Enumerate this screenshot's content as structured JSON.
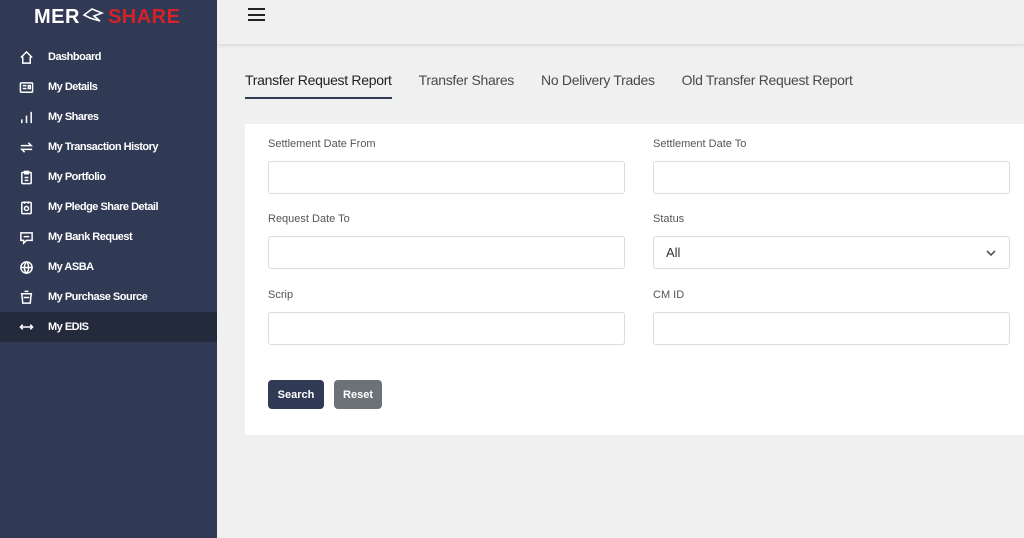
{
  "brand": {
    "part1": "MER",
    "part2": "SHARE"
  },
  "sidebar": {
    "items": [
      {
        "label": "Dashboard",
        "icon": "home-icon"
      },
      {
        "label": "My Details",
        "icon": "id-card-icon"
      },
      {
        "label": "My Shares",
        "icon": "bar-chart-icon"
      },
      {
        "label": "My Transaction History",
        "icon": "transfer-arrows-icon"
      },
      {
        "label": "My Portfolio",
        "icon": "clipboard-icon"
      },
      {
        "label": "My Pledge Share Detail",
        "icon": "pledge-clipboard-icon"
      },
      {
        "label": "My Bank Request",
        "icon": "message-icon"
      },
      {
        "label": "My ASBA",
        "icon": "globe-icon"
      },
      {
        "label": "My Purchase Source",
        "icon": "basket-icon"
      },
      {
        "label": "My EDIS",
        "icon": "exchange-icon",
        "active": true
      }
    ]
  },
  "tabs": [
    {
      "label": "Transfer Request Report",
      "active": true
    },
    {
      "label": "Transfer Shares"
    },
    {
      "label": "No Delivery Trades"
    },
    {
      "label": "Old Transfer Request Report"
    }
  ],
  "form": {
    "settlement_date_from": {
      "label": "Settlement Date From",
      "value": ""
    },
    "settlement_date_to": {
      "label": "Settlement Date To",
      "value": ""
    },
    "request_date_to": {
      "label": "Request Date To",
      "value": ""
    },
    "status": {
      "label": "Status",
      "value": "All"
    },
    "scrip": {
      "label": "Scrip",
      "value": ""
    },
    "cm_id": {
      "label": "CM ID",
      "value": ""
    }
  },
  "buttons": {
    "search": "Search",
    "reset": "Reset"
  },
  "colors": {
    "sidebar_bg": "#313a54",
    "active_item_bg": "#232a3c",
    "brand_red": "#d3222a",
    "reset_btn": "#6c7378"
  }
}
